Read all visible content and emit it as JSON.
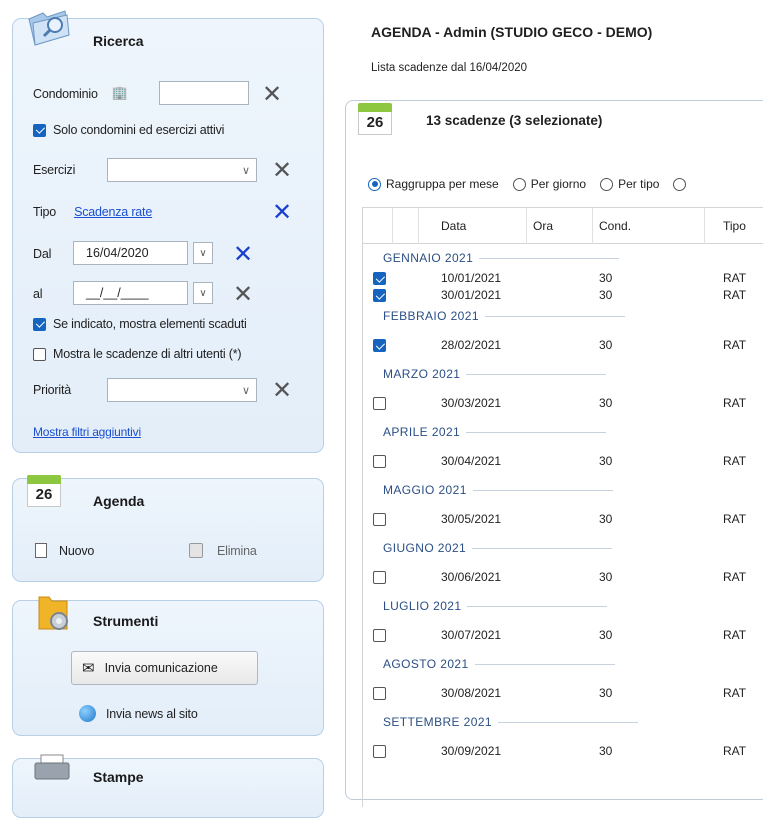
{
  "left": {
    "search": {
      "title": "Ricerca",
      "condominio_label": "Condominio",
      "condominio_value": "",
      "solo_attivi_label": "Solo condomini ed esercizi attivi",
      "solo_attivi_checked": true,
      "esercizi_label": "Esercizi",
      "tipo_label": "Tipo",
      "tipo_value": "Scadenza rate",
      "dal_label": "Dal",
      "dal_value": "16/04/2020",
      "al_label": "al",
      "al_value": "__/__/____",
      "scaduti_label": "Se indicato, mostra elementi scaduti",
      "scaduti_checked": true,
      "altri_utenti_label": "Mostra le scadenze di altri utenti (*)",
      "altri_utenti_checked": false,
      "priorita_label": "Priorità",
      "filtri_link": "Mostra filtri aggiuntivi"
    },
    "agenda": {
      "title": "Agenda",
      "calendar_day": "26",
      "nuovo_label": "Nuovo",
      "elimina_label": "Elimina"
    },
    "strumenti": {
      "title": "Strumenti",
      "invia_comunicazione": "Invia comunicazione",
      "invia_news": "Invia news al sito"
    },
    "stampe": {
      "title": "Stampe"
    }
  },
  "main": {
    "title": "AGENDA - Admin (STUDIO GECO - DEMO)",
    "subtitle": "Lista scadenze dal 16/04/2020",
    "box_title": "13 scadenze (3 selezionate)",
    "calendar_day": "26",
    "radios": [
      {
        "label": "Raggruppa per mese",
        "selected": true
      },
      {
        "label": "Per giorno",
        "selected": false
      },
      {
        "label": "Per tipo",
        "selected": false
      }
    ],
    "columns": [
      "Data",
      "Ora",
      "Cond.",
      "Tipo"
    ],
    "groups": [
      {
        "label": "GENNAIO 2021",
        "rows": [
          {
            "checked": true,
            "data": "10/01/2021",
            "ora": "",
            "cond": "30",
            "tipo": "RAT"
          },
          {
            "checked": true,
            "data": "30/01/2021",
            "ora": "",
            "cond": "30",
            "tipo": "RAT"
          }
        ]
      },
      {
        "label": "FEBBRAIO 2021",
        "rows": [
          {
            "checked": true,
            "data": "28/02/2021",
            "ora": "",
            "cond": "30",
            "tipo": "RAT"
          }
        ]
      },
      {
        "label": "MARZO 2021",
        "rows": [
          {
            "checked": false,
            "data": "30/03/2021",
            "ora": "",
            "cond": "30",
            "tipo": "RAT"
          }
        ]
      },
      {
        "label": "APRILE 2021",
        "rows": [
          {
            "checked": false,
            "data": "30/04/2021",
            "ora": "",
            "cond": "30",
            "tipo": "RAT"
          }
        ]
      },
      {
        "label": "MAGGIO 2021",
        "rows": [
          {
            "checked": false,
            "data": "30/05/2021",
            "ora": "",
            "cond": "30",
            "tipo": "RAT"
          }
        ]
      },
      {
        "label": "GIUGNO 2021",
        "rows": [
          {
            "checked": false,
            "data": "30/06/2021",
            "ora": "",
            "cond": "30",
            "tipo": "RAT"
          }
        ]
      },
      {
        "label": "LUGLIO 2021",
        "rows": [
          {
            "checked": false,
            "data": "30/07/2021",
            "ora": "",
            "cond": "30",
            "tipo": "RAT"
          }
        ]
      },
      {
        "label": "AGOSTO 2021",
        "rows": [
          {
            "checked": false,
            "data": "30/08/2021",
            "ora": "",
            "cond": "30",
            "tipo": "RAT"
          }
        ]
      },
      {
        "label": "SETTEMBRE 2021",
        "rows": [
          {
            "checked": false,
            "data": "30/09/2021",
            "ora": "",
            "cond": "30",
            "tipo": "RAT"
          }
        ]
      }
    ]
  }
}
